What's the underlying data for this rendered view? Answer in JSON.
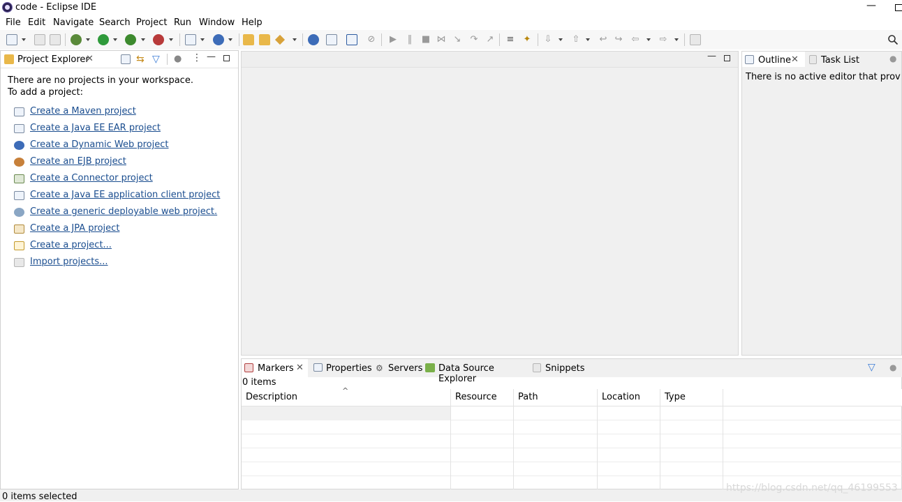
{
  "window": {
    "title": "code - Eclipse IDE"
  },
  "menu": [
    "File",
    "Edit",
    "Navigate",
    "Search",
    "Project",
    "Run",
    "Window",
    "Help"
  ],
  "left_panel": {
    "tab_label": "Project Explorer",
    "message_line1": "There are no projects in your workspace.",
    "message_line2": "To add a project:",
    "links": [
      "Create a Maven project",
      "Create a Java EE EAR project",
      "Create a Dynamic Web project",
      "Create an EJB project",
      "Create a Connector project",
      "Create a Java EE application client project",
      "Create a generic deployable web project.",
      "Create a JPA project",
      "Create a project...",
      "Import projects..."
    ]
  },
  "outline_panel": {
    "outline_tab": "Outline",
    "tasklist_tab": "Task List",
    "message": "There is no active editor that provides an outline."
  },
  "bottom_panel": {
    "tabs": [
      "Markers",
      "Properties",
      "Servers",
      "Data Source Explorer",
      "Snippets"
    ],
    "items_count": "0 items",
    "columns": [
      "Description",
      "Resource",
      "Path",
      "Location",
      "Type"
    ]
  },
  "status_bar": {
    "text": "0 items selected"
  },
  "watermark": "https://blog.csdn.net/qq_46199553"
}
